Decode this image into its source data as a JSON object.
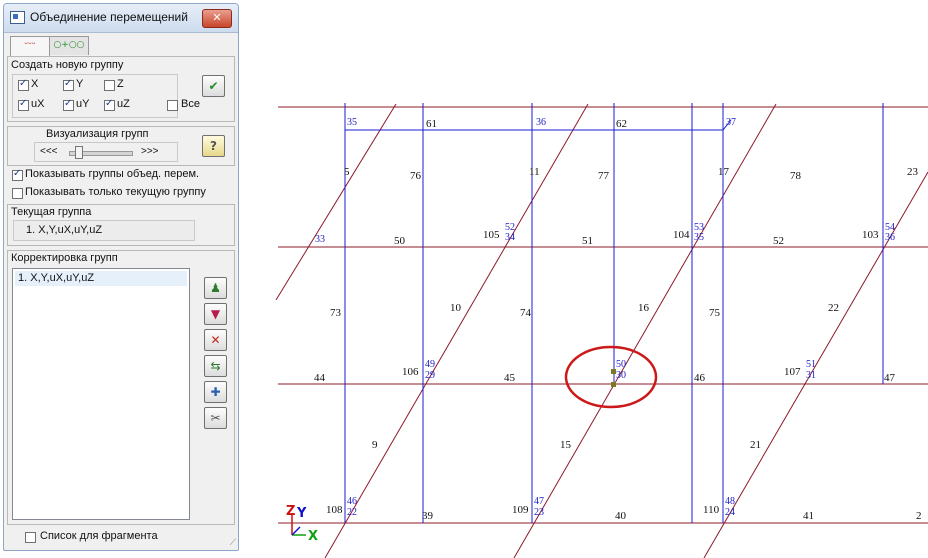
{
  "dialog": {
    "title": "Объединение перемещений",
    "close_label": "✕",
    "tabs": [
      "ᵕᵕᵕ",
      "○+○○"
    ],
    "create_group": {
      "title": "Создать новую группу",
      "checkboxes": [
        {
          "label": "X",
          "checked": true
        },
        {
          "label": "Y",
          "checked": true
        },
        {
          "label": "Z",
          "checked": false
        },
        {
          "label": "uX",
          "checked": true
        },
        {
          "label": "uY",
          "checked": true
        },
        {
          "label": "uZ",
          "checked": true
        },
        {
          "label": "Все",
          "checked": false
        }
      ],
      "apply_icon": "✔"
    },
    "visualization": {
      "title": "Визуализация групп",
      "left": "<<<",
      "right": ">>>",
      "help_label": "?"
    },
    "show_groups": {
      "label": "Показывать группы объед. перем.",
      "checked": true
    },
    "show_current_only": {
      "label": "Показывать только текущую группу",
      "checked": false
    },
    "current_group": {
      "title": "Текущая группа",
      "value": "1. X,Y,uX,uY,uZ"
    },
    "edit_groups": {
      "title": "Корректировка групп",
      "items": [
        "1. X,Y,uX,uY,uZ"
      ],
      "tool_icons": [
        "brush-icon",
        "filter-icon",
        "delete-icon",
        "move-icon",
        "add-icon",
        "edit-icon"
      ]
    },
    "fragment_list": {
      "label": "Список для фрагмента",
      "checked": false
    }
  },
  "axis": {
    "z": "Z",
    "y": "Y",
    "x": "X"
  },
  "colors": {
    "member_blue": "#1b1bd8",
    "member_red": "#8c1b2a",
    "node_label": "#2020c8",
    "highlight_circle": "#cc1a1a"
  },
  "labels": {
    "black": [
      {
        "t": "61"
      },
      {
        "t": "62"
      },
      {
        "t": "5"
      },
      {
        "t": "76"
      },
      {
        "t": "11"
      },
      {
        "t": "77"
      },
      {
        "t": "17"
      },
      {
        "t": "78"
      },
      {
        "t": "23"
      },
      {
        "t": "50"
      },
      {
        "t": "105"
      },
      {
        "t": "51"
      },
      {
        "t": "104"
      },
      {
        "t": "52"
      },
      {
        "t": "103"
      },
      {
        "t": "73"
      },
      {
        "t": "10"
      },
      {
        "t": "74"
      },
      {
        "t": "16"
      },
      {
        "t": "75"
      },
      {
        "t": "22"
      },
      {
        "t": "44"
      },
      {
        "t": "106"
      },
      {
        "t": "45"
      },
      {
        "t": "46"
      },
      {
        "t": "107"
      },
      {
        "t": "47"
      },
      {
        "t": "9"
      },
      {
        "t": "15"
      },
      {
        "t": "21"
      },
      {
        "t": "108"
      },
      {
        "t": "39"
      },
      {
        "t": "109"
      },
      {
        "t": "40"
      },
      {
        "t": "110"
      },
      {
        "t": "41"
      },
      {
        "t": "2"
      }
    ],
    "blue": [
      {
        "t": "35"
      },
      {
        "t": "36"
      },
      {
        "t": "37"
      },
      {
        "t": "33"
      },
      {
        "t": "52"
      },
      {
        "t": "34"
      },
      {
        "t": "53"
      },
      {
        "t": "35"
      },
      {
        "t": "54"
      },
      {
        "t": "36"
      },
      {
        "t": "49"
      },
      {
        "t": "29"
      },
      {
        "t": "50"
      },
      {
        "t": "30"
      },
      {
        "t": "51"
      },
      {
        "t": "31"
      },
      {
        "t": "46"
      },
      {
        "t": "22"
      },
      {
        "t": "47"
      },
      {
        "t": "23"
      },
      {
        "t": "48"
      },
      {
        "t": "24"
      }
    ]
  }
}
